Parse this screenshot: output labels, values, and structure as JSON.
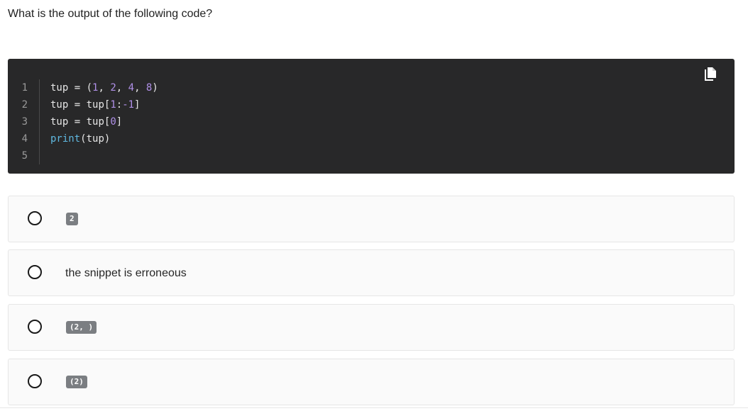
{
  "question": "What is the output of the following code?",
  "code": {
    "line_numbers": [
      "1",
      "2",
      "3",
      "4",
      "5"
    ],
    "copy_icon": "copy-icon",
    "lines": [
      [
        {
          "t": "tup",
          "c": "punc"
        },
        {
          "t": " = ",
          "c": "punc"
        },
        {
          "t": "(",
          "c": "punc"
        },
        {
          "t": "1",
          "c": "num"
        },
        {
          "t": ", ",
          "c": "punc"
        },
        {
          "t": "2",
          "c": "num"
        },
        {
          "t": ", ",
          "c": "punc"
        },
        {
          "t": "4",
          "c": "num"
        },
        {
          "t": ", ",
          "c": "punc"
        },
        {
          "t": "8",
          "c": "num"
        },
        {
          "t": ")",
          "c": "punc"
        }
      ],
      [
        {
          "t": "tup",
          "c": "punc"
        },
        {
          "t": " = ",
          "c": "punc"
        },
        {
          "t": "tup[",
          "c": "punc"
        },
        {
          "t": "1",
          "c": "num"
        },
        {
          "t": ":",
          "c": "punc"
        },
        {
          "t": "-1",
          "c": "num"
        },
        {
          "t": "]",
          "c": "punc"
        }
      ],
      [
        {
          "t": "tup",
          "c": "punc"
        },
        {
          "t": " = ",
          "c": "punc"
        },
        {
          "t": "tup[",
          "c": "punc"
        },
        {
          "t": "0",
          "c": "num"
        },
        {
          "t": "]",
          "c": "punc"
        }
      ],
      [
        {
          "t": "print",
          "c": "fn"
        },
        {
          "t": "(tup)",
          "c": "punc"
        }
      ],
      []
    ],
    "colors": {
      "background": "#282829",
      "number": "#b090e8",
      "function": "#5fb8e0",
      "text": "#e6e6e6"
    }
  },
  "options": [
    {
      "label": "2",
      "kind": "code"
    },
    {
      "label": "the snippet is erroneous",
      "kind": "text"
    },
    {
      "label": "(2, )",
      "kind": "code"
    },
    {
      "label": "(2)",
      "kind": "code"
    }
  ]
}
